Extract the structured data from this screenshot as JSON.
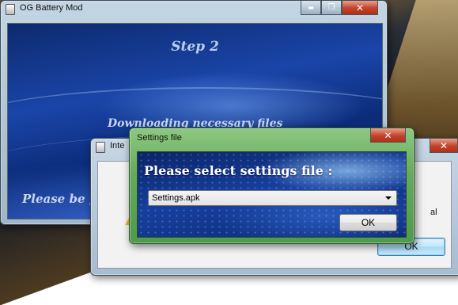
{
  "main_window": {
    "title": "OG Battery Mod",
    "step_text": "Step 2",
    "downloading_text": "Downloading necessary files",
    "please_text": "Please be p"
  },
  "background_window": {
    "title": "Inte",
    "partial_text": "al",
    "ok_label": "OK"
  },
  "settings_dialog": {
    "title": "Settings file",
    "heading": "Please select settings file :",
    "selected_value": "Settings.apk",
    "ok_label": "OK"
  },
  "caption_glyphs": {
    "minimize": "▬",
    "maximize": "❐",
    "close": "✕"
  },
  "icons": [
    "app-icon",
    "warning-icon",
    "dropdown-arrow-icon",
    "minimize-icon",
    "maximize-icon",
    "close-icon"
  ]
}
